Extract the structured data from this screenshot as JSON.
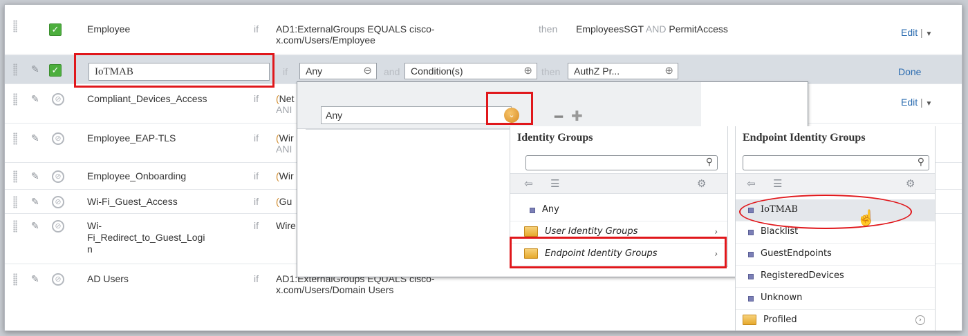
{
  "rows": [
    {
      "name": "Employee",
      "if": "if",
      "condition_line1": "AD1:ExternalGroups EQUALS cisco-",
      "condition_line2": "x.com/Users/Employee",
      "then": "then",
      "result_a": "EmployeesSGT",
      "result_and": "AND",
      "result_b": "PermitAccess",
      "edit": "Edit",
      "sep": "|",
      "caret": "▼"
    },
    {
      "name": "Compliant_Devices_Access",
      "if": "if",
      "cond_prefix": "(",
      "cond_visible": "Net",
      "cond_line2": "ANI",
      "edit": "Edit",
      "sep": "|",
      "caret": "▼"
    },
    {
      "name": "Employee_EAP-TLS",
      "if": "if",
      "cond_prefix": "(",
      "cond_visible": "Wir",
      "cond_line2": "ANI"
    },
    {
      "name": "Employee_Onboarding",
      "if": "if",
      "cond_prefix": "(",
      "cond_visible": "Wir"
    },
    {
      "name": "Wi-Fi_Guest_Access",
      "if": "if",
      "cond_prefix": "(",
      "cond_visible": "Gu"
    },
    {
      "name_line1": "Wi-",
      "name_line2": "Fi_Redirect_to_Guest_Logi",
      "name_line3": "n",
      "if": "if",
      "cond_visible": "Wire"
    },
    {
      "name": "AD Users",
      "if": "if",
      "condition_line1": "AD1:ExternalGroups EQUALS cisco-",
      "condition_line2": "x.com/Users/Domain Users"
    }
  ],
  "editing_row": {
    "name_value": "IoTMAB",
    "if": "if",
    "identity_segment": "Any",
    "and": "and",
    "conditions_segment": "Condition(s)",
    "then": "then",
    "authz_segment": "AuthZ Pr...",
    "done": "Done"
  },
  "popup": {
    "select_value": "Any"
  },
  "identity_groups": {
    "title": "Identity Groups",
    "items": [
      {
        "label": "Any",
        "kind": "item"
      },
      {
        "label": "User Identity Groups",
        "kind": "folder"
      },
      {
        "label": "Endpoint Identity Groups",
        "kind": "folder"
      }
    ]
  },
  "endpoint_identity_groups": {
    "title": "Endpoint Identity Groups",
    "items": [
      {
        "label": "IoTMAB",
        "kind": "item"
      },
      {
        "label": "Blacklist",
        "kind": "item"
      },
      {
        "label": "GuestEndpoints",
        "kind": "item"
      },
      {
        "label": "RegisteredDevices",
        "kind": "item"
      },
      {
        "label": "Unknown",
        "kind": "item"
      },
      {
        "label": "Profiled",
        "kind": "folder"
      }
    ]
  },
  "icons": {
    "check": "✓",
    "disabled": "⊘",
    "pencil": "✎",
    "search": "⚲",
    "back": "⇦",
    "list": "☰",
    "gear": "⚙",
    "chevron": "›",
    "dropdown": "⌄",
    "hand": "☝",
    "minus": "━",
    "plus": "✚",
    "segment_plus": "⊕",
    "segment_minus": "⊖",
    "circle_arrow": "›"
  },
  "colors": {
    "enabled_green": "#4cae3d",
    "highlight_red": "#e0171b",
    "link_blue": "#2b6cb0",
    "condition_orange": "#d08a2a"
  }
}
